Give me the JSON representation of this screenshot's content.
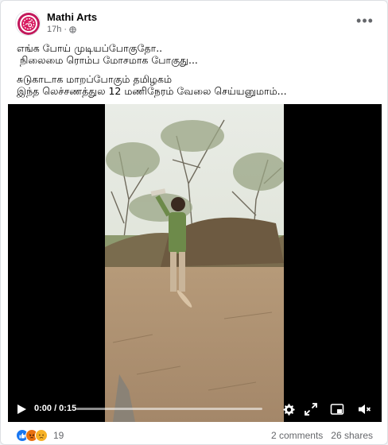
{
  "post": {
    "author": "Mathi Arts",
    "time": "17h",
    "dot": "·",
    "more_label": "•••",
    "caption_lines_1": [
      "எங்க போய் முடியப்போகுதோ..",
      " நிலைமை ரொம்ப மோசமாக போகுது..."
    ],
    "caption_lines_2": [
      "சுடுகாடாக மாறப்போகும் தமிழகம்",
      "இந்த லெச்சணத்துல 12 மணிநேரம் வேலை செய்யனுமாம்..."
    ]
  },
  "video": {
    "time_display": "0:00 / 0:15",
    "progress_fraction": 0.0
  },
  "footer": {
    "reaction_count": "19",
    "comments": "2 comments",
    "shares": "26 shares",
    "reactions": [
      {
        "name": "like",
        "color": "#1877f2"
      },
      {
        "name": "angry",
        "color": "#e9710f"
      },
      {
        "name": "sad",
        "color": "#f7b125"
      }
    ]
  },
  "colors": {
    "accent": "#1877f2",
    "avatar_ring": "#c2185b",
    "muted": "#65676b"
  }
}
